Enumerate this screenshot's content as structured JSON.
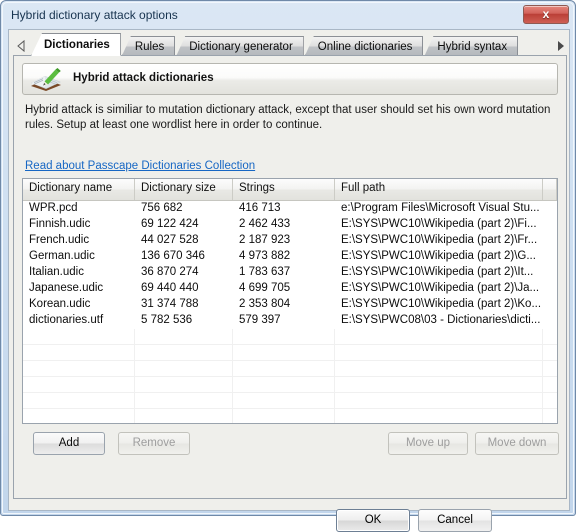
{
  "window": {
    "title": "Hybrid dictionary attack options",
    "close_label": "x"
  },
  "tabs": {
    "scroll_left_icon": "triangle-left-icon",
    "scroll_right_icon": "triangle-right-icon",
    "items": [
      {
        "label": "Dictionaries",
        "active": true
      },
      {
        "label": "Rules",
        "active": false
      },
      {
        "label": "Dictionary generator",
        "active": false
      },
      {
        "label": "Online dictionaries",
        "active": false
      },
      {
        "label": "Hybrid syntax",
        "active": false
      }
    ]
  },
  "section": {
    "icon": "book-with-pencil-icon",
    "title": "Hybrid attack dictionaries",
    "description": "Hybrid attack is similiar to mutation dictionary attack, except that user should set his own word mutation rules. Setup at least one wordlist here in order to continue."
  },
  "link": {
    "label": "Read about Passcape Dictionaries Collection",
    "color": "#1767c4"
  },
  "list": {
    "columns": [
      "Dictionary name",
      "Dictionary size",
      "Strings",
      "Full path"
    ],
    "rows": [
      {
        "name": "WPR.pcd",
        "size": "756 682",
        "strings": "416 713",
        "path": "e:\\Program Files\\Microsoft Visual Stu..."
      },
      {
        "name": "Finnish.udic",
        "size": "69 122 424",
        "strings": "2 462 433",
        "path": "E:\\SYS\\PWC10\\Wikipedia (part 2)\\Fi..."
      },
      {
        "name": "French.udic",
        "size": "44 027 528",
        "strings": "2 187 923",
        "path": "E:\\SYS\\PWC10\\Wikipedia (part 2)\\Fr..."
      },
      {
        "name": "German.udic",
        "size": "136 670 346",
        "strings": "4 973 882",
        "path": "E:\\SYS\\PWC10\\Wikipedia (part 2)\\G..."
      },
      {
        "name": "Italian.udic",
        "size": "36 870 274",
        "strings": "1 783 637",
        "path": "E:\\SYS\\PWC10\\Wikipedia (part 2)\\It..."
      },
      {
        "name": "Japanese.udic",
        "size": "69 440 440",
        "strings": "4 699 705",
        "path": "E:\\SYS\\PWC10\\Wikipedia (part 2)\\Ja..."
      },
      {
        "name": "Korean.udic",
        "size": "31 374 788",
        "strings": "2 353 804",
        "path": "E:\\SYS\\PWC10\\Wikipedia (part 2)\\Ko..."
      },
      {
        "name": "dictionaries.utf",
        "size": "5 782 536",
        "strings": "579 397",
        "path": "E:\\SYS\\PWC08\\03 - Dictionaries\\dicti..."
      }
    ],
    "empty_row_count": 6
  },
  "list_buttons": {
    "add": "Add",
    "remove": "Remove",
    "move_up": "Move up",
    "move_down": "Move down"
  },
  "footer": {
    "ok": "OK",
    "cancel": "Cancel"
  }
}
